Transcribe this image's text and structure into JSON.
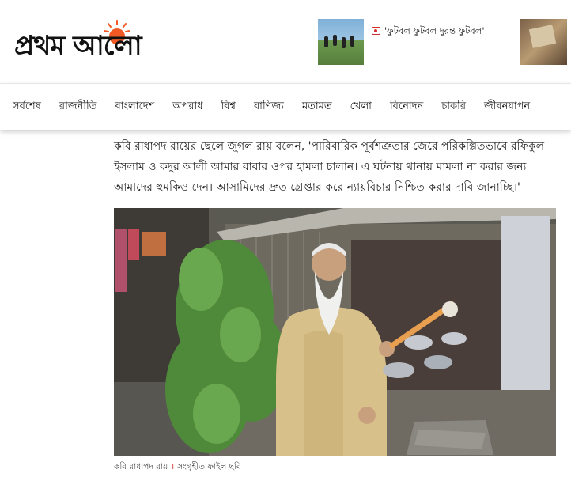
{
  "brand": {
    "logo_text": "প্রথম আলো",
    "accent_color": "#f15a24"
  },
  "header": {
    "headline": {
      "icon": "camera-icon",
      "icon_color": "#d32f2f",
      "text": "'ফুটবল ফুটবল দুরন্ত ফুটবল'"
    }
  },
  "nav": {
    "items": [
      "সর্বশেষ",
      "রাজনীতি",
      "বাংলাদেশ",
      "অপরাধ",
      "বিশ্ব",
      "বাণিজ্য",
      "মতামত",
      "খেলা",
      "বিনোদন",
      "চাকরি",
      "জীবনযাপন"
    ]
  },
  "article": {
    "paragraph": "কবি রাধাপদ রায়ের ছেলে জুগল রায় বলেন, 'পারিবারিক পূর্বশত্রুতার জেরে পরিকল্পিতভাবে রফিকুল ইসলাম ও কদুর আলী আমার বাবার ওপর হামলা চালান। এ ঘটনায় থানায় মামলা না করার জন্য আমাদের হুমকিও দেন। আসামিদের দ্রুত গ্রেপ্তার করে ন্যায়বিচার নিশ্চিত করার দাবি জানাচ্ছি।'",
    "caption_subject": "কবি রাধাপদ রায়",
    "caption_separator": "।",
    "caption_credit": "সংগৃহীত ফাইল ছবি"
  }
}
